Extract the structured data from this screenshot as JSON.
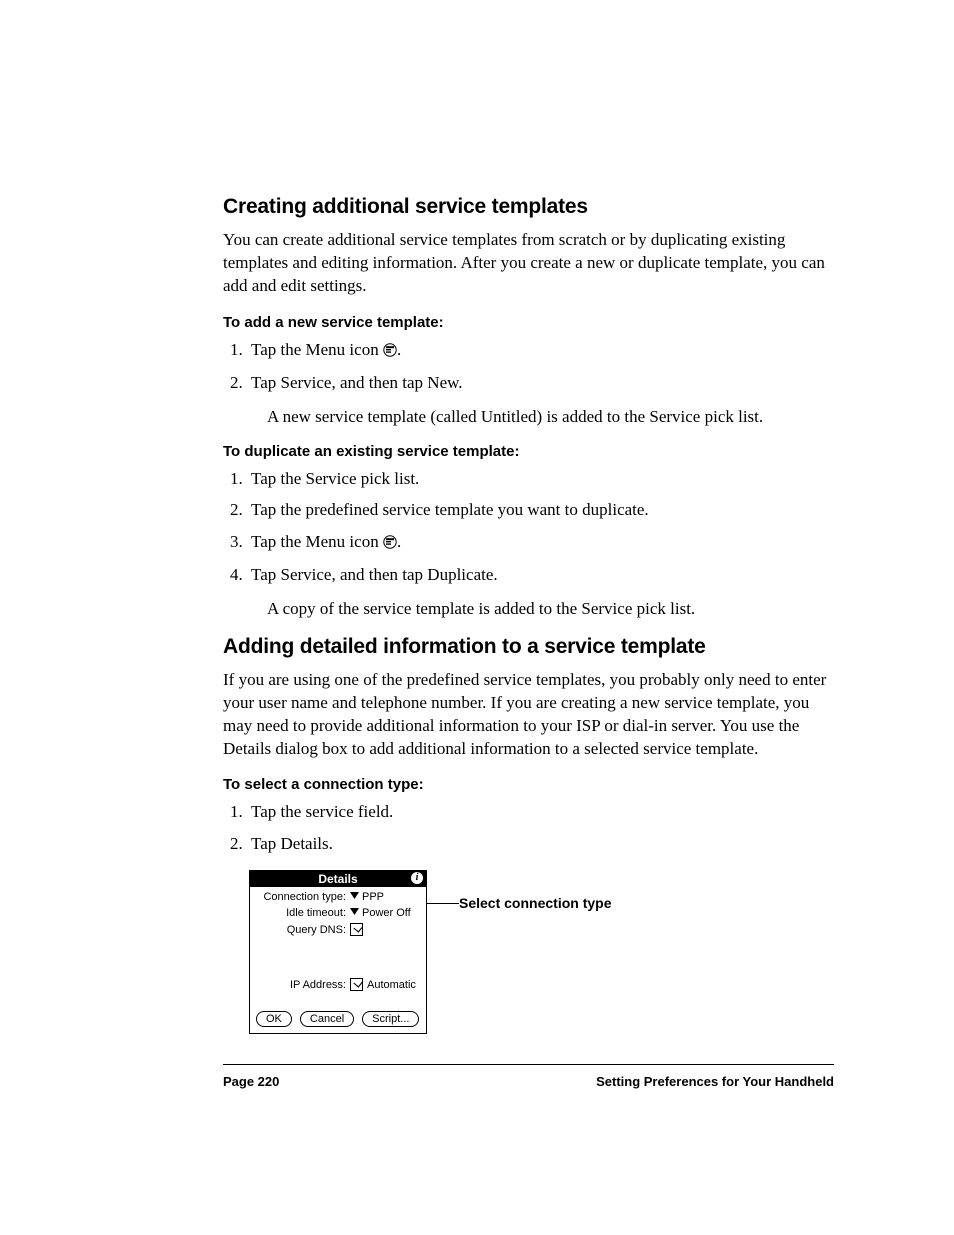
{
  "heading1": "Creating additional service templates",
  "para1": "You can create additional service templates from scratch or by duplicating existing templates and editing information. After you create a new or duplicate template, you can add and edit settings.",
  "subA": "To add a new service template:",
  "stepsA": [
    "Tap the Menu icon",
    "Tap Service, and then tap New."
  ],
  "noteA": "A new service template (called Untitled) is added to the Service pick list.",
  "subB": "To duplicate an existing service template:",
  "stepsB": [
    "Tap the Service pick list.",
    "Tap the predefined service template you want to duplicate.",
    "Tap the Menu icon",
    "Tap Service, and then tap Duplicate."
  ],
  "noteB": "A copy of the service template is added to the Service pick list.",
  "heading2": "Adding detailed information to a service template",
  "para2": "If you are using one of the predefined service templates, you probably only need to enter your user name and telephone number. If you are creating a new service template, you may need to provide additional information to your ISP or dial-in server. You use the Details dialog box to add additional information to a selected service template.",
  "subC": "To select a connection type:",
  "stepsC": [
    "Tap the service field.",
    "Tap Details."
  ],
  "dialog": {
    "title": "Details",
    "rows": {
      "conn_label": "Connection type:",
      "conn_value": "PPP",
      "idle_label": "Idle timeout:",
      "idle_value": "Power Off",
      "dns_label": "Query DNS:",
      "ip_label": "IP Address:",
      "ip_value": "Automatic"
    },
    "buttons": {
      "ok": "OK",
      "cancel": "Cancel",
      "script": "Script..."
    }
  },
  "callout": "Select connection type",
  "footer": {
    "left": "Page 220",
    "right": "Setting Preferences for Your Handheld"
  }
}
